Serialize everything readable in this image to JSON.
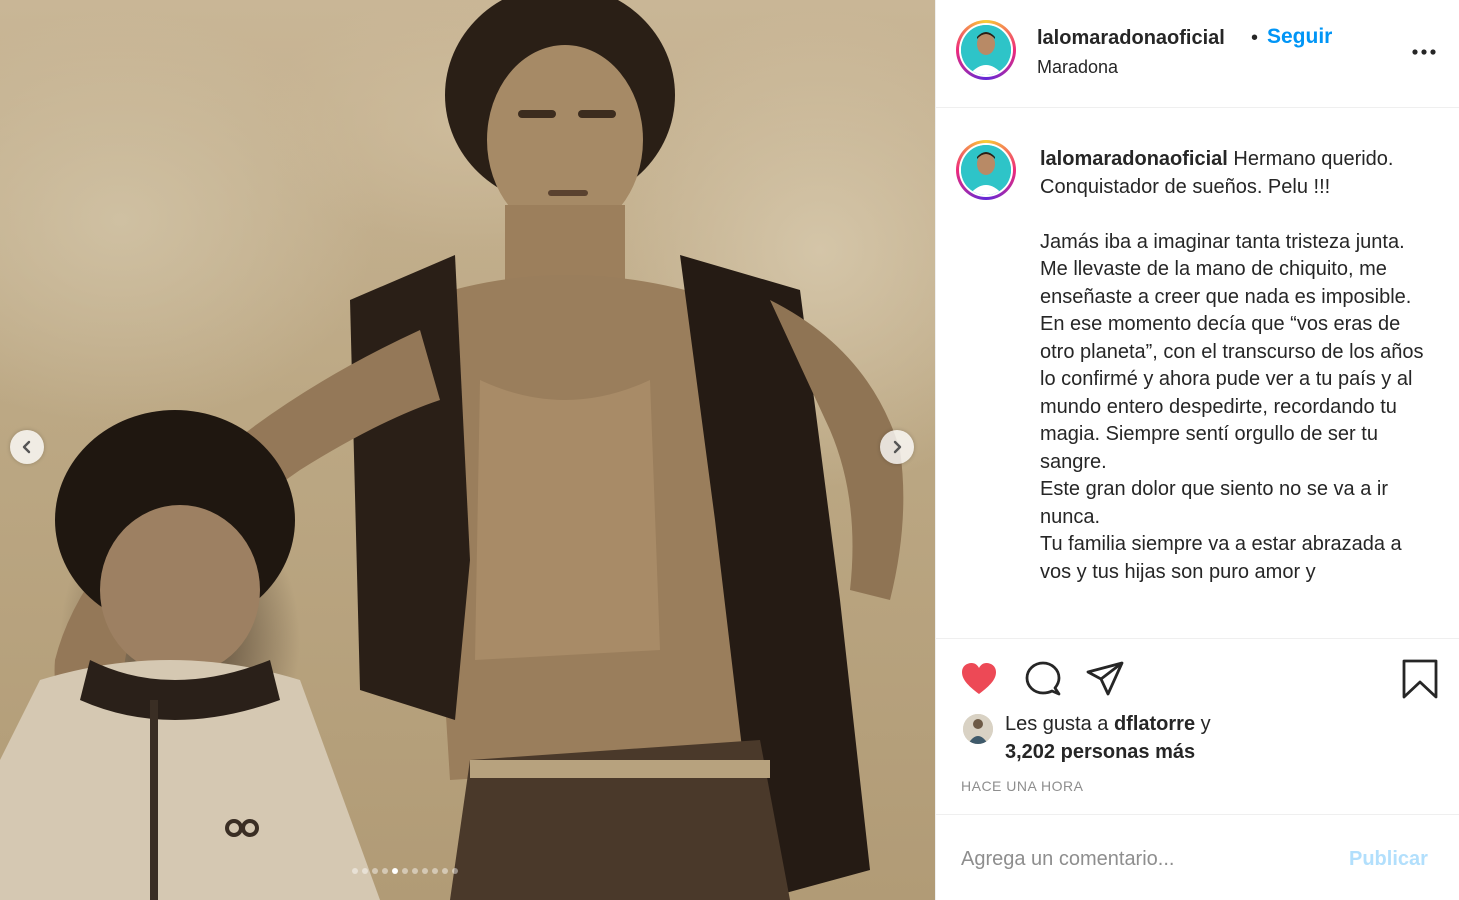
{
  "post": {
    "username": "lalomaradonaoficial",
    "follow_label": "Seguir",
    "bullet": "•",
    "location": "Maradona"
  },
  "caption": {
    "username": "lalomaradonaoficial",
    "text": " Hermano querido. Conquistador de sueños. Pelu !!!\n\nJamás iba a imaginar tanta tristeza junta. Me llevaste de la mano de chiquito, me enseñaste a creer que nada es imposible. En ese momento decía que “vos eras de otro planeta”, con el transcurso de los años lo confirmé y ahora pude ver a tu país y al mundo entero despedirte, recordando tu magia. Siempre sentí orgullo de ser tu sangre.\nEste gran dolor que siento no se va a ir nunca.\nTu familia siempre va a estar abrazada a vos y tus hijas son puro amor y"
  },
  "likes": {
    "prefix": "Les gusta a ",
    "user": "dflatorre",
    "suffix": " y",
    "others": "3,202 personas más"
  },
  "timestamp": "HACE UNA HORA",
  "comment": {
    "placeholder": "Agrega un comentario...",
    "publish_label": "Publicar"
  },
  "icons": {
    "like": "heart-filled-icon",
    "comment": "comment-icon",
    "share": "paper-plane-icon",
    "save": "bookmark-icon",
    "more": "more-dots-icon",
    "prev": "chevron-left-icon",
    "next": "chevron-right-icon"
  },
  "colors": {
    "like_red": "#ed4956",
    "link_blue": "#0095f6",
    "publish_disabled": "#b2dffc",
    "muted": "#8e8e8e"
  },
  "carousel": {
    "total": 11,
    "active_index": 4
  }
}
